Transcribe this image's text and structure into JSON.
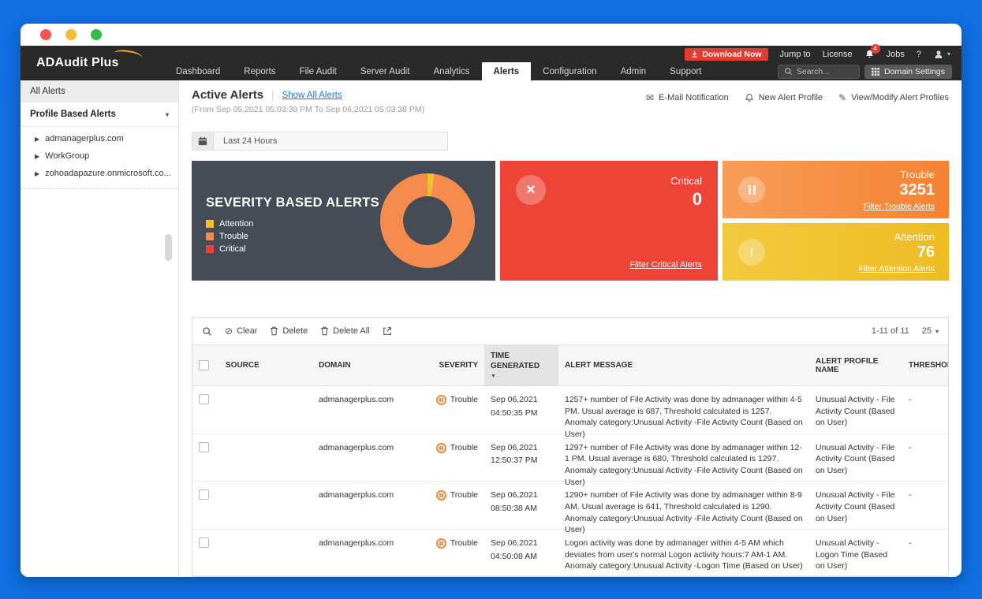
{
  "topbar": {
    "logo": "ADAudit Plus",
    "utility": {
      "download": "Download Now",
      "jump_to": "Jump to",
      "license": "License",
      "bell_badge": "4",
      "jobs": "Jobs",
      "help": "?"
    },
    "nav": [
      "Dashboard",
      "Reports",
      "File Audit",
      "Server Audit",
      "Analytics",
      "Alerts",
      "Configuration",
      "Admin",
      "Support"
    ],
    "search_placeholder": "Search...",
    "domain_settings": "Domain Settings"
  },
  "sidebar": {
    "header": "All Alerts",
    "group": "Profile Based Alerts",
    "items": [
      "admanagerplus.com",
      "WorkGroup",
      "zohoadapazure.onmicrosoft.co..."
    ]
  },
  "page": {
    "title": "Active Alerts",
    "show_all": "Show All Alerts",
    "date_range": "(From Sep 05,2021 05:03:38 PM To Sep 06,2021 05:03:38 PM)",
    "actions": {
      "email": "E-Mail Notification",
      "new_profile": "New Alert Profile",
      "modify": "View/Modify Alert Profiles"
    },
    "time_filter": "Last 24 Hours"
  },
  "severity_panel": {
    "title": "SEVERITY BASED ALERTS",
    "legend": [
      {
        "label": "Attention",
        "color": "#f2c02e"
      },
      {
        "label": "Trouble",
        "color": "#f58b4c"
      },
      {
        "label": "Critical",
        "color": "#ee4237"
      }
    ]
  },
  "chart_data": {
    "type": "pie",
    "donut": true,
    "title": "SEVERITY BASED ALERTS",
    "categories": [
      "Attention",
      "Trouble",
      "Critical"
    ],
    "values": [
      76,
      3251,
      0
    ],
    "colors": [
      "#f2c02e",
      "#f58b4c",
      "#ee4237"
    ],
    "legend_position": "left"
  },
  "cards": {
    "critical": {
      "label": "Critical",
      "value": "0",
      "link": "Filter Critical Alerts",
      "color": "#ee4437"
    },
    "trouble": {
      "label": "Trouble",
      "value": "3251",
      "link": "Filter Trouble Alerts",
      "color": "#f58634"
    },
    "attention": {
      "label": "Attention",
      "value": "76",
      "link": "Filter Attention Alerts",
      "color": "#edbc22"
    }
  },
  "table": {
    "toolbar": {
      "clear": "Clear",
      "delete": "Delete",
      "delete_all": "Delete All"
    },
    "pagination": {
      "range": "1-11 of 11",
      "size": "25"
    },
    "columns": {
      "source": "SOURCE",
      "domain": "DOMAIN",
      "severity": "SEVERITY",
      "time": "TIME GENERATED",
      "message": "ALERT MESSAGE",
      "profile": "ALERT PROFILE NAME",
      "threshold": "THRESHOLD"
    },
    "rows": [
      {
        "source": "",
        "domain": "admanagerplus.com",
        "severity": "Trouble",
        "date": "Sep 06,2021",
        "time": "04:50:35 PM",
        "message": "1257+ number of File Activity was done by admanager within 4-5 PM. Usual average is 687, Threshold calculated is 1257. Anomaly category:Unusual Activity -File Activity Count (Based on User)",
        "profile": "Unusual Activity - File Activity Count (Based on User)",
        "threshold": "-"
      },
      {
        "source": "",
        "domain": "admanagerplus.com",
        "severity": "Trouble",
        "date": "Sep 06,2021",
        "time": "12:50:37 PM",
        "message": "1297+ number of File Activity was done by admanager within 12-1 PM. Usual average is 680, Threshold calculated is 1297. Anomaly category:Unusual Activity -File Activity Count (Based on User)",
        "profile": "Unusual Activity - File Activity Count (Based on User)",
        "threshold": "-"
      },
      {
        "source": "",
        "domain": "admanagerplus.com",
        "severity": "Trouble",
        "date": "Sep 06,2021",
        "time": "08:50:38 AM",
        "message": "1290+ number of File Activity was done by admanager within 8-9 AM. Usual average is 641, Threshold calculated is 1290. Anomaly category:Unusual Activity -File Activity Count (Based on User)",
        "profile": "Unusual Activity - File Activity Count (Based on User)",
        "threshold": "-"
      },
      {
        "source": "",
        "domain": "admanagerplus.com",
        "severity": "Trouble",
        "date": "Sep 06,2021",
        "time": "04:50:08 AM",
        "message": "Logon activity was done by admanager within 4-5 AM which deviates from user's normal Logon activity hours:7 AM-1 AM. Anomaly category:Unusual Activity -Logon Time (Based on User)",
        "profile": "Unusual Activity - Logon Time (Based on User)",
        "threshold": "-"
      }
    ]
  },
  "colors": {
    "frame_blue": "#1070e4",
    "topbar_dark": "#2a2a2a",
    "panel_dark": "#454c55",
    "critical": "#ee4437",
    "trouble": "#f58634",
    "attention": "#edbc22",
    "brand_red": "#e53c31",
    "link_blue": "#1f7ad4"
  }
}
